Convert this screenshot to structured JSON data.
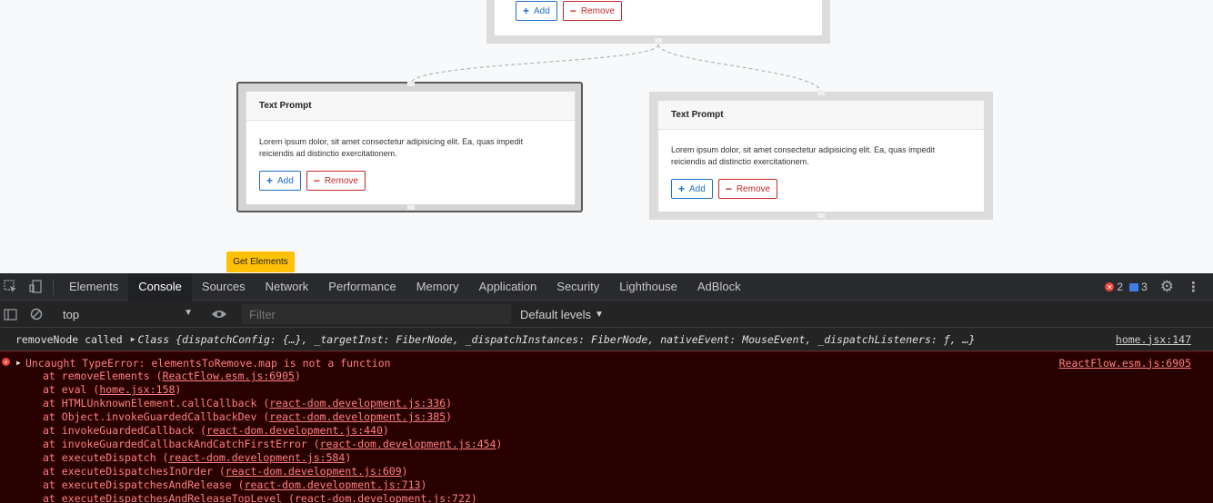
{
  "canvas": {
    "nodes": [
      {
        "id": "root",
        "add_label": "Add",
        "remove_label": "Remove"
      },
      {
        "id": "left",
        "title": "Text Prompt",
        "body": "Lorem ipsum dolor, sit amet consectetur adipisicing elit. Ea, quas impedit reiciendis ad distinctio exercitationem.",
        "add_label": "Add",
        "remove_label": "Remove"
      },
      {
        "id": "right",
        "title": "Text Prompt",
        "body": "Lorem ipsum dolor, sit amet consectetur adipisicing elit. Ea, quas impedit reiciendis ad distinctio exercitationem.",
        "add_label": "Add",
        "remove_label": "Remove"
      }
    ],
    "get_elements_label": "Get Elements",
    "colors": {
      "add": "#1f6fc7",
      "remove": "#c62828",
      "get_elements": "#ffc107"
    }
  },
  "devtools": {
    "tabs": [
      "Elements",
      "Console",
      "Sources",
      "Network",
      "Performance",
      "Memory",
      "Application",
      "Security",
      "Lighthouse",
      "AdBlock"
    ],
    "active_tab": "Console",
    "error_count": "2",
    "message_count": "3",
    "context": "top",
    "filter_placeholder": "Filter",
    "levels": "Default levels",
    "log": {
      "text": "removeNode called",
      "object": "Class {dispatchConfig: {…}, _targetInst: FiberNode, _dispatchInstances: FiberNode, nativeEvent: MouseEvent, _dispatchListeners: ƒ, …}",
      "source": "home.jsx:147"
    },
    "error": {
      "message": "Uncaught TypeError: elementsToRemove.map is not a function",
      "source": "ReactFlow.esm.js:6905",
      "stack": [
        {
          "fn": "at removeElements",
          "loc": "ReactFlow.esm.js:6905"
        },
        {
          "fn": "at eval",
          "loc": "home.jsx:158"
        },
        {
          "fn": "at HTMLUnknownElement.callCallback",
          "loc": "react-dom.development.js:336"
        },
        {
          "fn": "at Object.invokeGuardedCallbackDev",
          "loc": "react-dom.development.js:385"
        },
        {
          "fn": "at invokeGuardedCallback",
          "loc": "react-dom.development.js:440"
        },
        {
          "fn": "at invokeGuardedCallbackAndCatchFirstError",
          "loc": "react-dom.development.js:454"
        },
        {
          "fn": "at executeDispatch",
          "loc": "react-dom.development.js:584"
        },
        {
          "fn": "at executeDispatchesInOrder",
          "loc": "react-dom.development.js:609"
        },
        {
          "fn": "at executeDispatchesAndRelease",
          "loc": "react-dom.development.js:713"
        },
        {
          "fn": "at executeDispatchesAndReleaseTopLevel",
          "loc": "react-dom.development.js:722"
        }
      ]
    }
  }
}
